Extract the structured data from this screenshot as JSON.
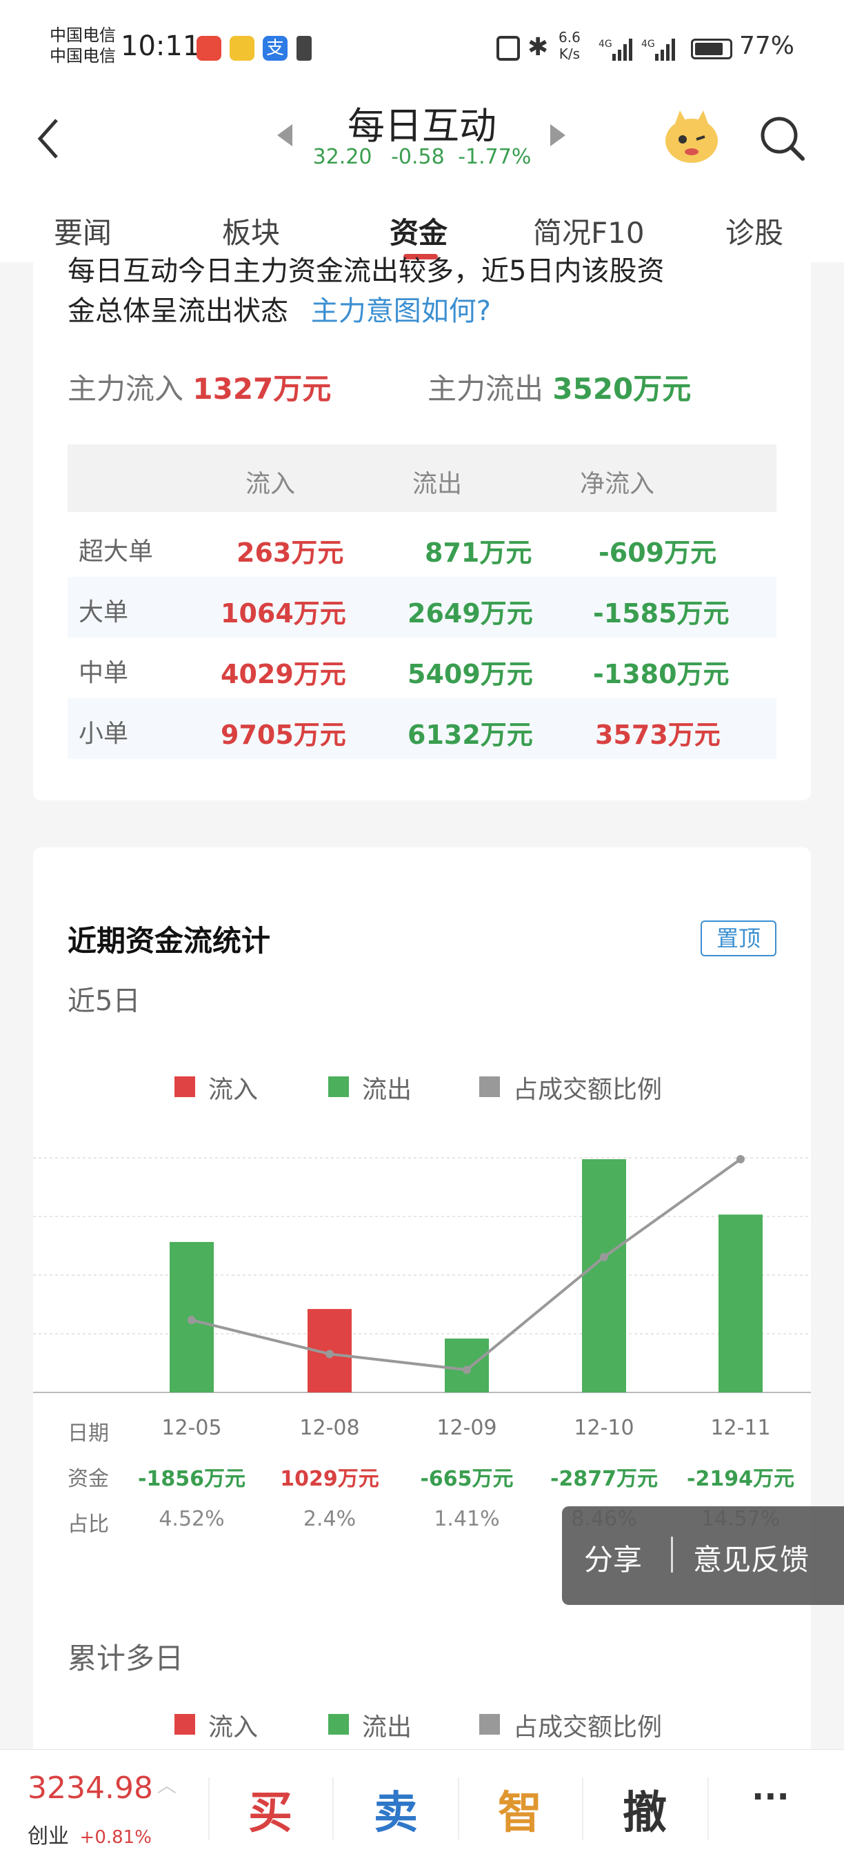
{
  "status": {
    "carrier1": "中国电信",
    "carrier2": "中国电信",
    "time": "10:11",
    "net_speed_top": "6.6",
    "net_speed_bottom": "K/s",
    "battery": "77%"
  },
  "header": {
    "title": "每日互动",
    "price": "32.20",
    "change": "-0.58",
    "change_pct": "-1.77%"
  },
  "tabs": [
    "要闻",
    "板块",
    "资金",
    "简况F10",
    "诊股"
  ],
  "summary": {
    "line1": "每日互动今日主力资金流出较多，近5日内该股资",
    "line2": "金总体呈流出状态",
    "link": "主力意图如何?",
    "inflow_label": "主力流入",
    "inflow_value": "1327万元",
    "outflow_label": "主力流出",
    "outflow_value": "3520万元"
  },
  "flow_table": {
    "headers": [
      "流入",
      "流出",
      "净流入"
    ],
    "rows": [
      {
        "label": "超大单",
        "in": "263万元",
        "out": "871万元",
        "net": "-609万元"
      },
      {
        "label": "大单",
        "in": "1064万元",
        "out": "2649万元",
        "net": "-1585万元"
      },
      {
        "label": "中单",
        "in": "4029万元",
        "out": "5409万元",
        "net": "-1380万元"
      },
      {
        "label": "小单",
        "in": "9705万元",
        "out": "6132万元",
        "net": "3573万元"
      }
    ]
  },
  "recent": {
    "title": "近期资金流统计",
    "pin_button": "置顶",
    "period_label": "近5日",
    "legend_in": "流入",
    "legend_out": "流出",
    "legend_ratio": "占成交额比例",
    "row_date_label": "日期",
    "row_fund_label": "资金",
    "row_ratio_label": "占比",
    "multi_label": "累计多日"
  },
  "chart_data": {
    "type": "bar",
    "categories": [
      "12-05",
      "12-08",
      "12-09",
      "12-10",
      "12-11"
    ],
    "fund_labels": [
      "-1856万元",
      "1029万元",
      "-665万元",
      "-2877万元",
      "-2194万元"
    ],
    "values": [
      -1856,
      1029,
      -665,
      -2877,
      -2194
    ],
    "ratio_labels": [
      "4.52%",
      "2.4%",
      "1.41%",
      "8.46%",
      "14.57%"
    ],
    "ratio": [
      4.52,
      2.4,
      1.41,
      8.46,
      14.57
    ],
    "colors": {
      "inflow": "#e04343",
      "outflow": "#4caf5c",
      "ratio_line": "#999999"
    }
  },
  "popup": {
    "share": "分享",
    "feedback": "意见反馈"
  },
  "bottom": {
    "index_value": "3234.98",
    "index_name": "创业",
    "index_change": "+0.81%",
    "buy": "买",
    "sell": "卖",
    "smart": "智",
    "cancel": "撤",
    "more": "···"
  }
}
